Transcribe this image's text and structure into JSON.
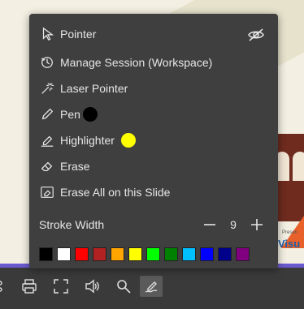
{
  "slide": {
    "visible_text_fragment": "Visu",
    "small_text_fragment": "Presen"
  },
  "menu": {
    "items": [
      {
        "label": "Pointer",
        "icon": "pointer-icon"
      },
      {
        "label": "Manage Session (Workspace)",
        "icon": "manage-session-icon"
      },
      {
        "label": "Laser Pointer",
        "icon": "laser-pointer-icon"
      },
      {
        "label": "Pen",
        "icon": "pen-icon",
        "color": "#000000"
      },
      {
        "label": "Highlighter",
        "icon": "highlighter-icon",
        "color": "#ffff00"
      },
      {
        "label": "Erase",
        "icon": "eraser-icon"
      },
      {
        "label": "Erase All on this Slide",
        "icon": "erase-all-icon"
      }
    ],
    "stroke_width_label": "Stroke Width",
    "stroke_width_value": "9",
    "colors": [
      "#000000",
      "#ffffff",
      "#ff0000",
      "#b22222",
      "#ffa500",
      "#ffff00",
      "#00ff00",
      "#008000",
      "#00bfff",
      "#0000ff",
      "#00008b",
      "#800080"
    ]
  },
  "toolbar": {
    "buttons": [
      "more-icon",
      "print-icon",
      "fullscreen-icon",
      "volume-icon",
      "zoom-icon",
      "annotate-icon"
    ]
  }
}
